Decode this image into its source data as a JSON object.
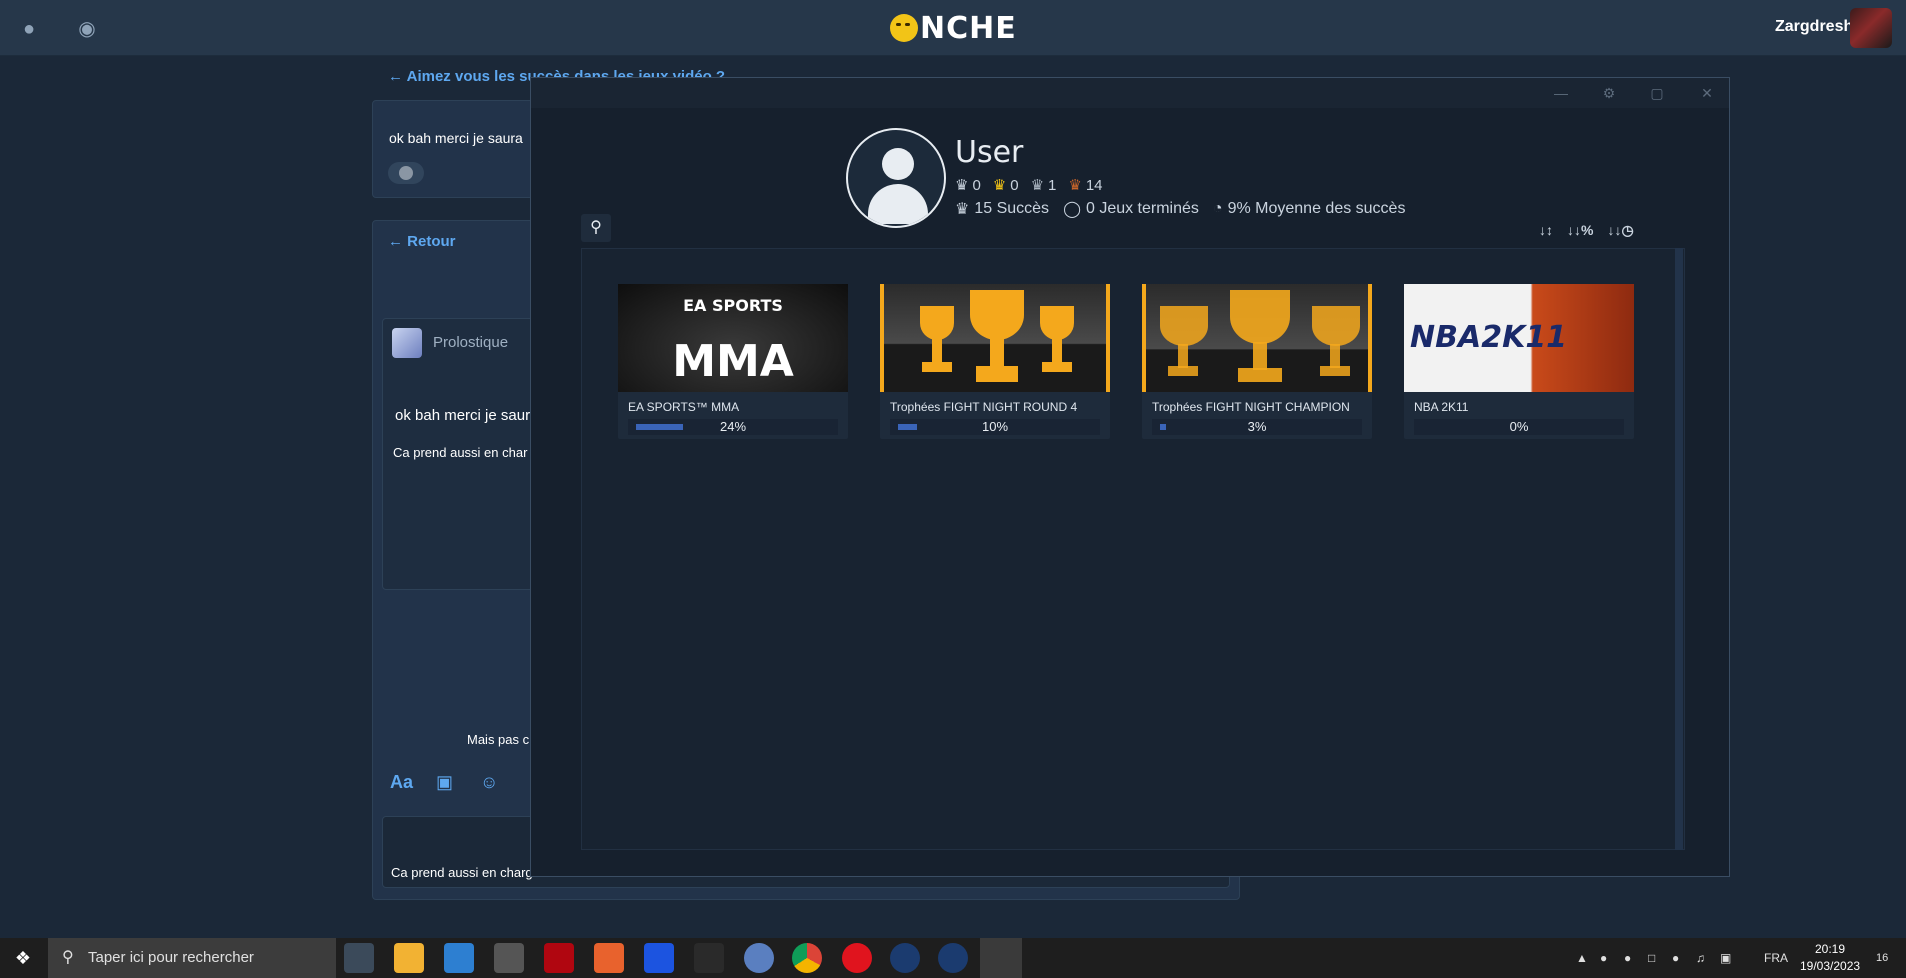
{
  "site": {
    "logo_text": "NCHE",
    "username": "Zargdresh"
  },
  "forum": {
    "topic_link": "Aimez vous les succès dans les jeux vidéo ?",
    "post_excerpt": "ok bah merci je saura",
    "back_label": "Retour",
    "author": "Prolostique",
    "quote_excerpt": "ok bah merci je saur",
    "reply_excerpt": "Ca prend aussi en char",
    "mais_text": "Mais pas c",
    "bottom_excerpt": "Ca prend aussi en charg",
    "toolbar_aa": "Aa"
  },
  "modal": {
    "profile_name": "User",
    "trophies": {
      "platinum": "0",
      "gold": "0",
      "silver": "1",
      "bronze": "14"
    },
    "stats": {
      "achievements": "15 Succès",
      "completed_games": "0 Jeux terminés",
      "average": "9% Moyenne des succès"
    },
    "sort_buttons": [
      "A-Z",
      "%",
      "time"
    ],
    "games": [
      {
        "title": "EA SPORTS™ MMA",
        "percent_label": "24%",
        "progress": 0.24,
        "image": "mma"
      },
      {
        "title": "Trophées FIGHT NIGHT ROUND 4",
        "percent_label": "10%",
        "progress": 0.1,
        "image": "trophy"
      },
      {
        "title": "Trophées FIGHT NIGHT CHAMPION",
        "percent_label": "3%",
        "progress": 0.03,
        "image": "trophy"
      },
      {
        "title": "NBA 2K11",
        "percent_label": "0%",
        "progress": 0.0,
        "image": "nba"
      }
    ],
    "mma_logo_top": "EA SPORTS",
    "mma_logo_bottom": "MMA",
    "nba_logo": "NBA2K11"
  },
  "taskbar": {
    "search_placeholder": "Taper ici pour rechercher",
    "language": "FRA",
    "time": "20:19",
    "date": "19/03/2023",
    "notification_count": "16"
  },
  "colors": {
    "accent_link": "#5ea8f0",
    "progress_fill": "#3a64b8",
    "trophy_gold": "#f4a81c",
    "bronze": "#c8652a"
  }
}
